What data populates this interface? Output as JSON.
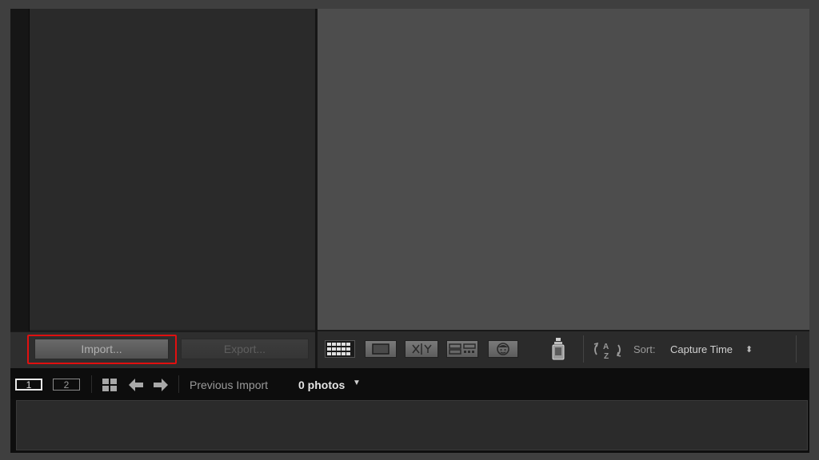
{
  "left_toolbar": {
    "import_label": "Import...",
    "export_label": "Export..."
  },
  "main_toolbar": {
    "view_icons": [
      "grid-view-icon",
      "loupe-view-icon",
      "compare-view-icon",
      "survey-view-icon",
      "people-view-icon"
    ],
    "compare_text": "X|Y",
    "sort_label": "Sort:",
    "sort_value": "Capture Time",
    "sort_toggle": "⬍"
  },
  "filmstrip_bar": {
    "monitor_1": "1",
    "monitor_2": "2",
    "source_label": "Previous Import",
    "photo_count": "0 photos",
    "dropdown_glyph": "▼"
  },
  "colors": {
    "highlight": "#e01010",
    "main_view_bg": "#4d4d4d",
    "left_panel_bg": "#2a2a2a"
  }
}
